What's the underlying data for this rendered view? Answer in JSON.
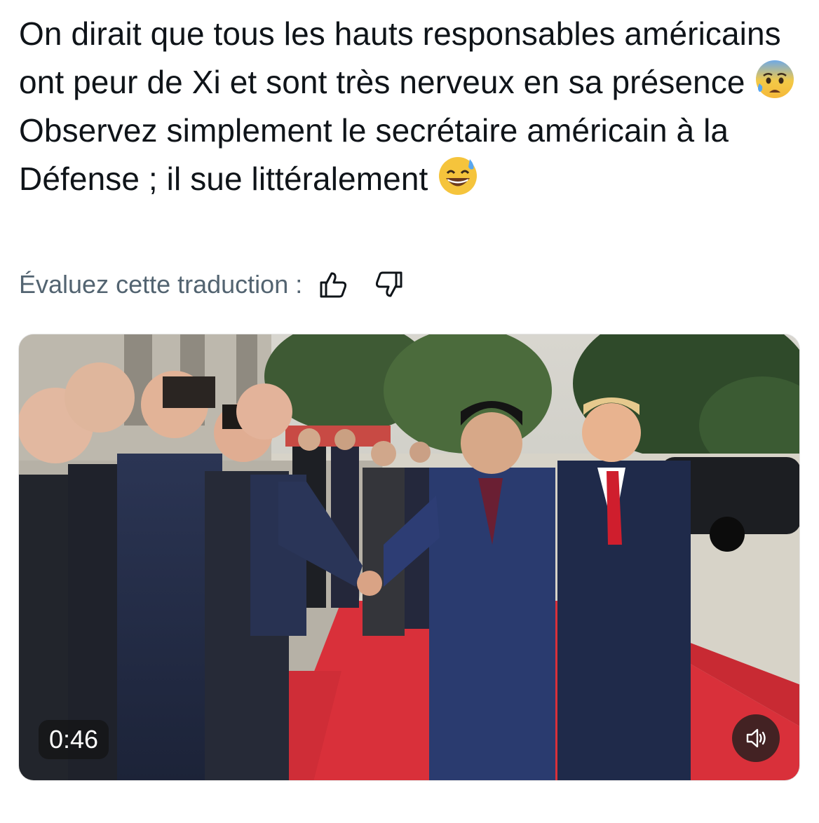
{
  "tweet": {
    "text_part1": "On dirait que tous les hauts responsables américains ont peur de Xi et sont très nerveux en sa présence ",
    "emoji_1": "anxious-face-with-sweat",
    "text_part2": " Observez simplement le secrétaire américain à la Défense ; il sue littéralement ",
    "emoji_2": "grinning-face-with-sweat"
  },
  "translation_rating": {
    "label": "Évaluez cette traduction :",
    "thumbs_up_icon": "thumbs-up-icon",
    "thumbs_down_icon": "thumbs-down-icon"
  },
  "video": {
    "duration": "0:46",
    "volume_icon": "speaker-muted-icon"
  },
  "colors": {
    "text": "#0f1419",
    "secondary_text": "#536471",
    "carpet": "#d9303a",
    "overlay": "#141414"
  }
}
